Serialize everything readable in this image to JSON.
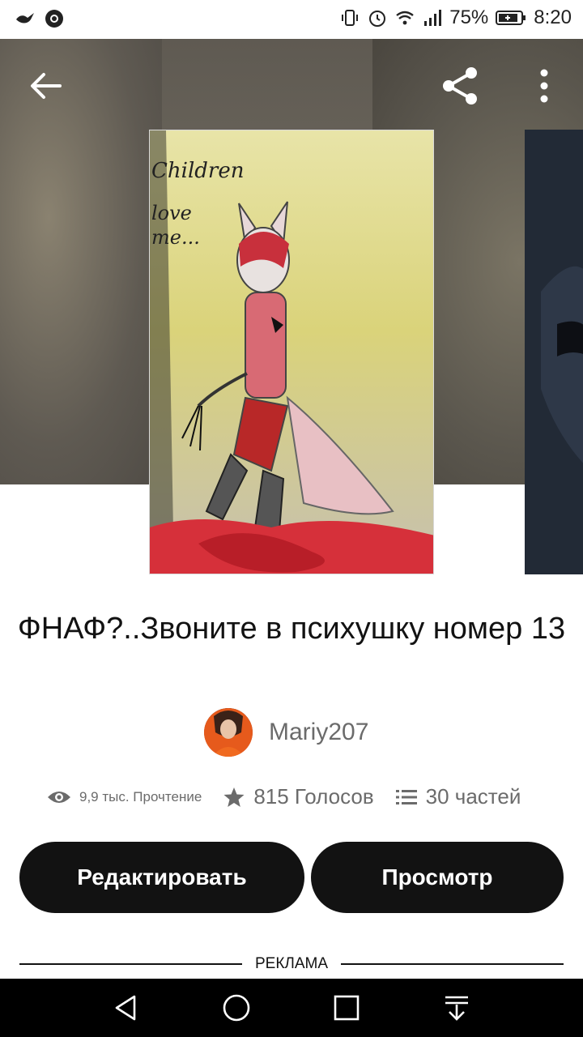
{
  "status_bar": {
    "battery": "75%",
    "time": "8:20"
  },
  "book": {
    "title": "ФНАФ?..Звоните в психушку номер 13",
    "author": "Mariy207",
    "cover_text": "Children love me..."
  },
  "stats": {
    "reads": "9,9 тыс. Прочтение",
    "votes": "815 Голосов",
    "parts": "30 частей"
  },
  "actions": {
    "edit_label": "Редактировать",
    "view_label": "Просмотр"
  },
  "ad": {
    "label": "РЕКЛАМА"
  },
  "icons": {
    "back": "arrow-left-icon",
    "share": "share-icon",
    "more": "more-vert-icon",
    "reads": "eye-icon",
    "votes": "star-icon",
    "parts": "list-icon"
  },
  "colors": {
    "button_bg": "#121212",
    "button_text": "#ffffff",
    "meta_text": "#6b6b6b"
  }
}
